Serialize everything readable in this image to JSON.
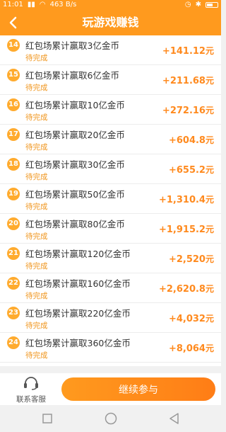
{
  "status_bar": {
    "time": "11:01",
    "speed": "463 B/s"
  },
  "header": {
    "title": "玩游戏赚钱"
  },
  "tasks": [
    {
      "num": "14",
      "title": "红包场累计赢取3亿金币",
      "status": "待完成",
      "reward": "+141.12",
      "unit": "元"
    },
    {
      "num": "15",
      "title": "红包场累计赢取6亿金币",
      "status": "待完成",
      "reward": "+211.68",
      "unit": "元"
    },
    {
      "num": "16",
      "title": "红包场累计赢取10亿金币",
      "status": "待完成",
      "reward": "+272.16",
      "unit": "元"
    },
    {
      "num": "17",
      "title": "红包场累计赢取20亿金币",
      "status": "待完成",
      "reward": "+604.8",
      "unit": "元"
    },
    {
      "num": "18",
      "title": "红包场累计赢取30亿金币",
      "status": "待完成",
      "reward": "+655.2",
      "unit": "元"
    },
    {
      "num": "19",
      "title": "红包场累计赢取50亿金币",
      "status": "待完成",
      "reward": "+1,310.4",
      "unit": "元"
    },
    {
      "num": "20",
      "title": "红包场累计赢取80亿金币",
      "status": "待完成",
      "reward": "+1,915.2",
      "unit": "元"
    },
    {
      "num": "21",
      "title": "红包场累计赢取120亿金币",
      "status": "待完成",
      "reward": "+2,520",
      "unit": "元"
    },
    {
      "num": "22",
      "title": "红包场累计赢取160亿金币",
      "status": "待完成",
      "reward": "+2,620.8",
      "unit": "元"
    },
    {
      "num": "23",
      "title": "红包场累计赢取220亿金币",
      "status": "待完成",
      "reward": "+4,032",
      "unit": "元"
    },
    {
      "num": "24",
      "title": "红包场累计赢取360亿金币",
      "status": "待完成",
      "reward": "+8,064",
      "unit": "元"
    }
  ],
  "bottom": {
    "customer_service": "联系客服",
    "continue": "继续参与"
  },
  "colors": {
    "accent": "#ff9a1e",
    "reward": "#ff8a1e",
    "status": "#f0951c"
  },
  "icons": {
    "back": "chevron-left-icon",
    "service": "headset-icon"
  }
}
